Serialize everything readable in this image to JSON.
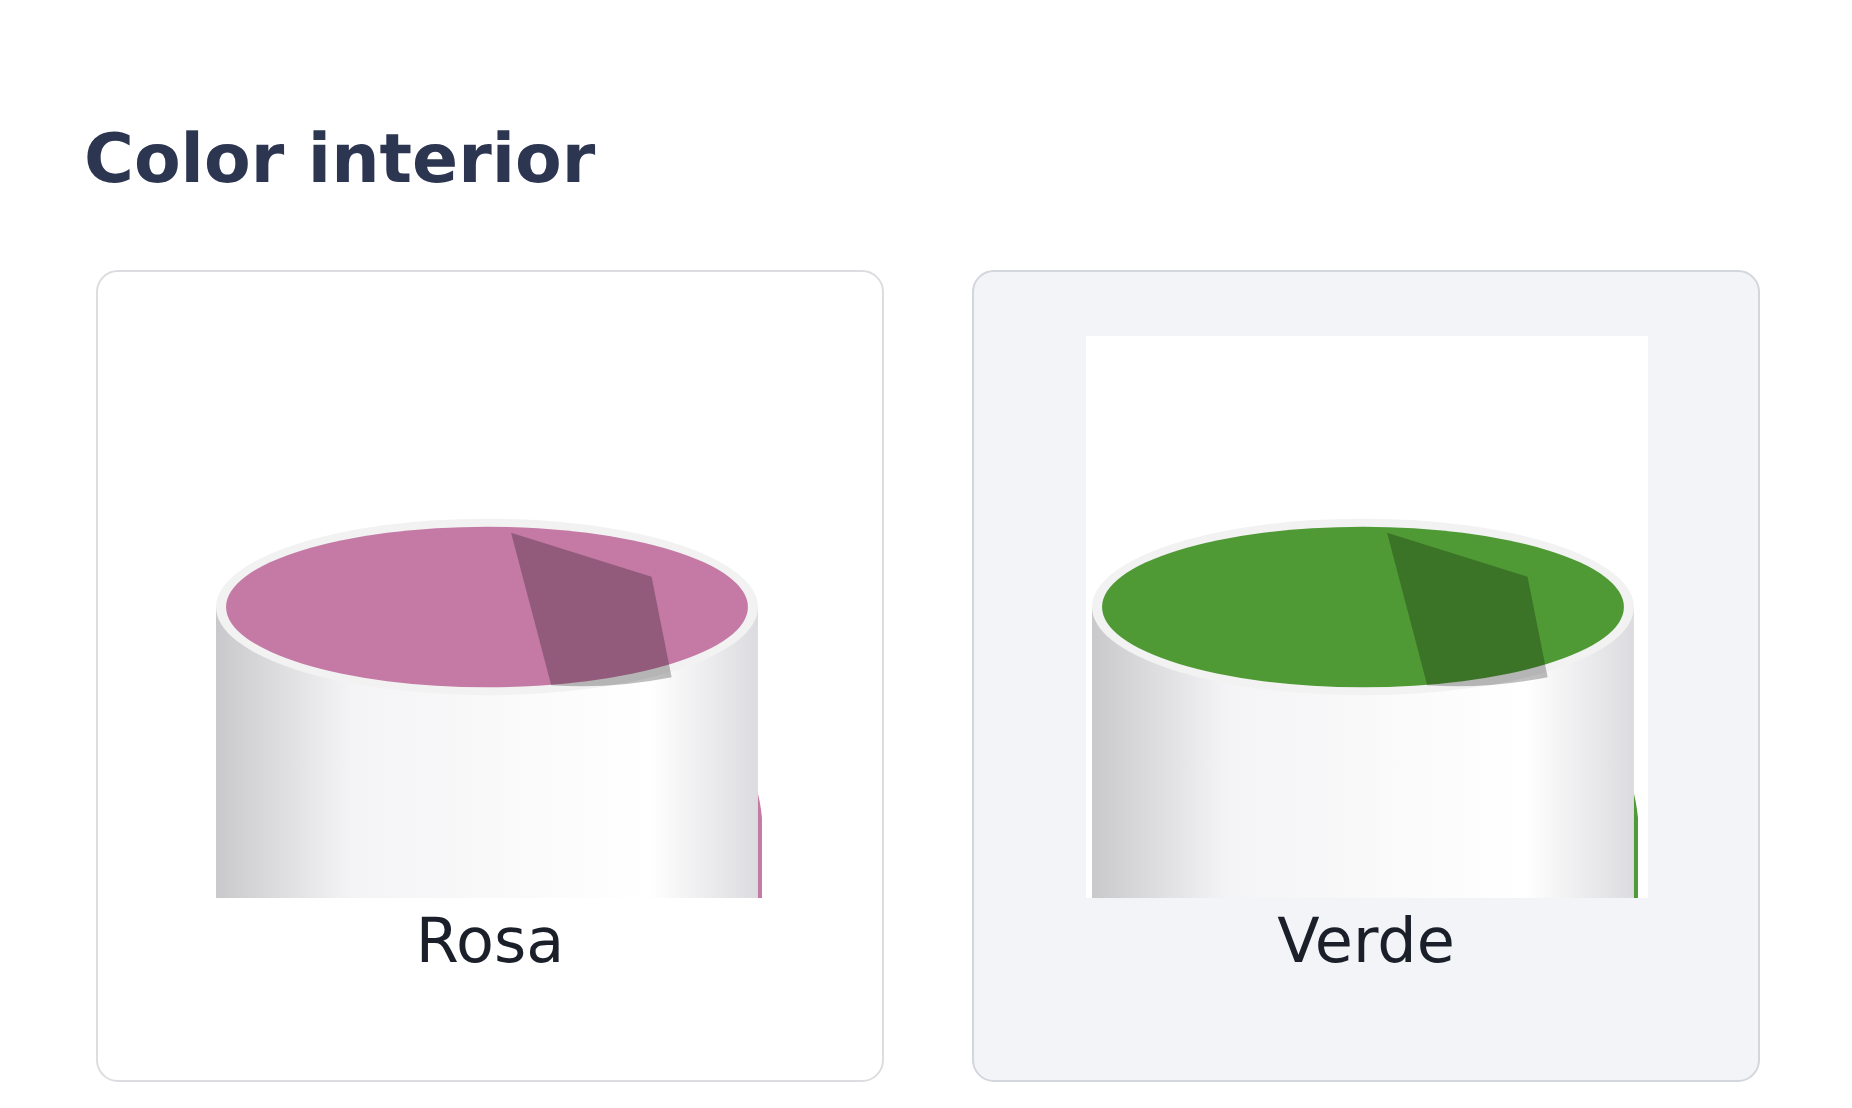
{
  "section": {
    "title": "Color interior"
  },
  "options": [
    {
      "label": "Rosa",
      "color": "#c47aa5",
      "selected": false
    },
    {
      "label": "Verde",
      "color": "#4f9a35",
      "selected": true
    }
  ]
}
